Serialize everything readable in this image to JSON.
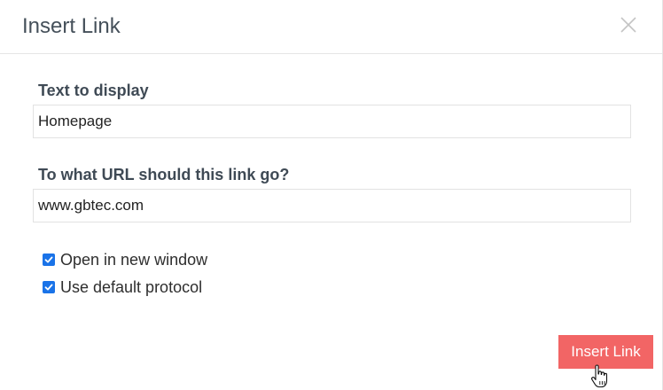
{
  "dialog": {
    "title": "Insert Link",
    "close_icon": "close-icon"
  },
  "form": {
    "display_text": {
      "label": "Text to display",
      "value": "Homepage"
    },
    "url": {
      "label": "To what URL should this link go?",
      "value": "www.gbtec.com"
    },
    "options": [
      {
        "label": "Open in new window",
        "checked": true
      },
      {
        "label": "Use default protocol",
        "checked": true
      }
    ]
  },
  "footer": {
    "insert_label": "Insert Link"
  },
  "colors": {
    "accent": "#f26565",
    "checkbox": "#1a73e8",
    "title": "#45505a"
  }
}
